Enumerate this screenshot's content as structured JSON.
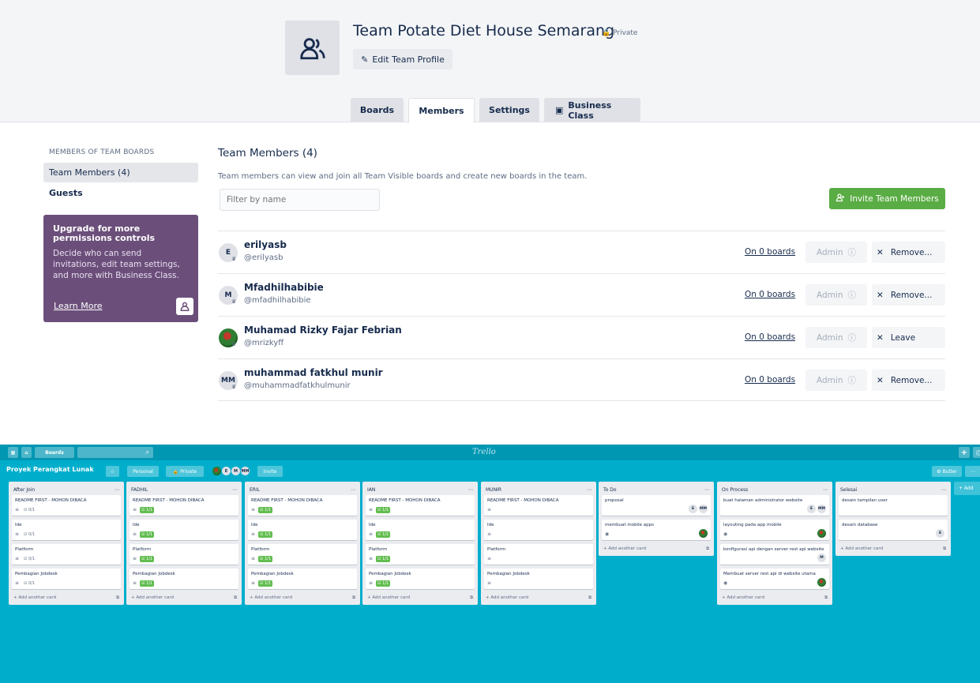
{
  "team": {
    "name": "Team Potate Diet House Semarang",
    "privacy": "Private",
    "edit_label": "Edit Team Profile",
    "tabs": [
      {
        "label": "Boards"
      },
      {
        "label": "Members"
      },
      {
        "label": "Settings"
      },
      {
        "label": "Business Class"
      }
    ]
  },
  "sidebar": {
    "heading": "MEMBERS OF TEAM BOARDS",
    "items": [
      {
        "label": "Team Members (4)"
      },
      {
        "label": "Guests"
      }
    ],
    "upgrade": {
      "title": "Upgrade for more permissions controls",
      "text": "Decide who can send invitations, edit team settings, and more with Business Class.",
      "link": "Learn More"
    }
  },
  "members": {
    "title": "Team Members (4)",
    "description": "Team members can view and join all Team Visible boards and create new boards in the team.",
    "filter_placeholder": "Filter by name",
    "invite_label": "Invite Team Members",
    "rows": [
      {
        "initials": "E",
        "name": "erilyasb",
        "username": "@erilyasb",
        "boards": "On 0 boards",
        "role": "Admin",
        "action": "Remove..."
      },
      {
        "initials": "M",
        "name": "Mfadhilhabibie",
        "username": "@mfadhilhabibie",
        "boards": "On 0 boards",
        "role": "Admin",
        "action": "Remove..."
      },
      {
        "initials": "",
        "name": "Muhamad Rizky Fajar Febrian",
        "username": "@mrizkyff",
        "boards": "On 0 boards",
        "role": "Admin",
        "action": "Leave"
      },
      {
        "initials": "MM",
        "name": "muhammad fatkhul munir",
        "username": "@muhammadfatkhulmunir",
        "boards": "On 0 boards",
        "role": "Admin",
        "action": "Remove..."
      }
    ]
  },
  "board": {
    "topbar": {
      "boards_label": "Boards",
      "logo": "Trello"
    },
    "title": "Proyek Perangkat Lunak",
    "personal_label": "Personal",
    "private_label": "Private",
    "member_initials": [
      "E",
      "M",
      "MM"
    ],
    "invite_label": "Invite",
    "butler_label": "Butler",
    "add_card_label": "+ Add another card",
    "add_list_label": "+ Add",
    "lists": [
      {
        "name": "After Join",
        "cards": [
          {
            "title": "README FIRST - MOHON DIBACA",
            "check": "0/1",
            "done": false
          },
          {
            "title": "Ide",
            "check": "0/1",
            "done": false
          },
          {
            "title": "Platform",
            "check": "0/1",
            "done": false
          },
          {
            "title": "Pembagian Jobdesk",
            "check": "0/1",
            "done": false
          }
        ]
      },
      {
        "name": "FADHIL",
        "cards": [
          {
            "title": "README FIRST - MOHON DIBACA",
            "check": "1/1",
            "done": true
          },
          {
            "title": "Ide",
            "check": "1/1",
            "done": true
          },
          {
            "title": "Platform",
            "check": "1/1",
            "done": true
          },
          {
            "title": "Pembagian Jobdesk",
            "check": "1/1",
            "done": true
          }
        ]
      },
      {
        "name": "ERIL",
        "cards": [
          {
            "title": "README FIRST - MOHON DIBACA",
            "check": "1/1",
            "done": true
          },
          {
            "title": "Ide",
            "check": "1/1",
            "done": true
          },
          {
            "title": "Platform",
            "check": "1/1",
            "done": true
          },
          {
            "title": "Pembagian Jobdesk",
            "check": "1/1",
            "done": true
          }
        ]
      },
      {
        "name": "IAN",
        "cards": [
          {
            "title": "README FIRST - MOHON DIBACA",
            "check": "1/1",
            "done": true
          },
          {
            "title": "Ide",
            "check": "1/1",
            "done": true
          },
          {
            "title": "Platform",
            "check": "1/1",
            "done": true
          },
          {
            "title": "Pembagian Jobdesk",
            "check": "1/1",
            "done": true
          }
        ]
      },
      {
        "name": "MUNIR",
        "cards": [
          {
            "title": "README FIRST - MOHON DIBACA",
            "check": "",
            "done": false
          },
          {
            "title": "Ide",
            "check": "",
            "done": false
          },
          {
            "title": "Platform",
            "check": "",
            "done": false
          },
          {
            "title": "Pembagian Jobdesk",
            "check": "",
            "done": false
          }
        ]
      },
      {
        "name": "To Do",
        "cards": [
          {
            "title": "proposal",
            "avatars": [
              "E",
              "MM"
            ]
          },
          {
            "title": "membuat mobile apps",
            "watch": true,
            "avatars": [
              "photo"
            ]
          }
        ]
      },
      {
        "name": "On Process",
        "cards": [
          {
            "title": "buat halaman administrator website",
            "avatars": [
              "E",
              "MM"
            ]
          },
          {
            "title": "layouting pada app mobile",
            "watch": true,
            "avatars": [
              "photo"
            ]
          },
          {
            "title": "konfigurasi api dengan server rest api website",
            "avatars": [
              "M"
            ]
          },
          {
            "title": "Membuat server rest api di website utama",
            "watch": true,
            "avatars": [
              "photo"
            ]
          }
        ]
      },
      {
        "name": "Selesai",
        "cards": [
          {
            "title": "desain tampilan user",
            "avatars": []
          },
          {
            "title": "desain database",
            "avatars": [
              "E"
            ]
          }
        ]
      }
    ]
  }
}
